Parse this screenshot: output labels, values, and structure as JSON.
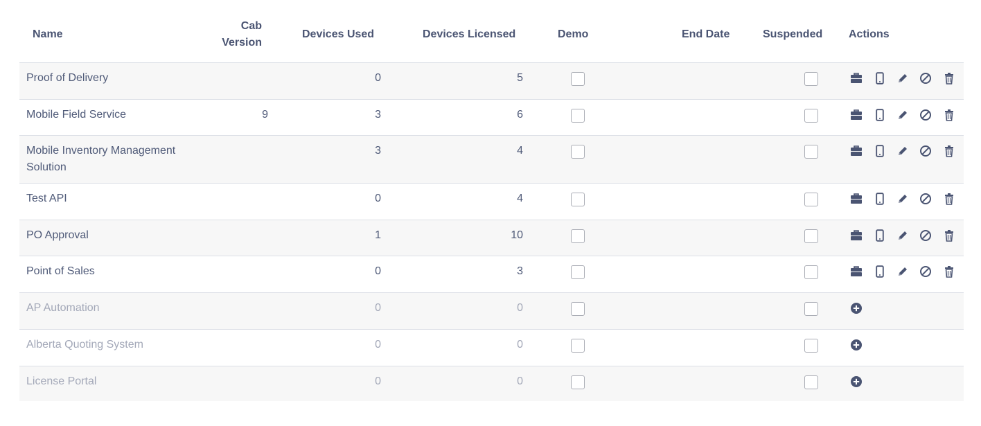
{
  "table": {
    "headers": {
      "name": "Name",
      "cab_line1": "Cab",
      "cab_line2": "Version",
      "used": "Devices Used",
      "licensed": "Devices Licensed",
      "demo": "Demo",
      "end_date": "End Date",
      "suspended": "Suspended",
      "actions": "Actions"
    },
    "rows": [
      {
        "name": "Proof of Delivery",
        "cab_version": "",
        "devices_used": "0",
        "devices_licensed": "5",
        "demo": false,
        "end_date": "",
        "suspended": false,
        "active": true
      },
      {
        "name": "Mobile Field Service",
        "cab_version": "9",
        "devices_used": "3",
        "devices_licensed": "6",
        "demo": false,
        "end_date": "",
        "suspended": false,
        "active": true
      },
      {
        "name": "Mobile Inventory Management Solution",
        "cab_version": "",
        "devices_used": "3",
        "devices_licensed": "4",
        "demo": false,
        "end_date": "",
        "suspended": false,
        "active": true
      },
      {
        "name": "Test API",
        "cab_version": "",
        "devices_used": "0",
        "devices_licensed": "4",
        "demo": false,
        "end_date": "",
        "suspended": false,
        "active": true
      },
      {
        "name": "PO Approval",
        "cab_version": "",
        "devices_used": "1",
        "devices_licensed": "10",
        "demo": false,
        "end_date": "",
        "suspended": false,
        "active": true
      },
      {
        "name": "Point of Sales",
        "cab_version": "",
        "devices_used": "0",
        "devices_licensed": "3",
        "demo": false,
        "end_date": "",
        "suspended": false,
        "active": true
      },
      {
        "name": "AP Automation",
        "cab_version": "",
        "devices_used": "0",
        "devices_licensed": "0",
        "demo": false,
        "end_date": "",
        "suspended": false,
        "active": false
      },
      {
        "name": "Alberta Quoting System",
        "cab_version": "",
        "devices_used": "0",
        "devices_licensed": "0",
        "demo": false,
        "end_date": "",
        "suspended": false,
        "active": false
      },
      {
        "name": "License Portal",
        "cab_version": "",
        "devices_used": "0",
        "devices_licensed": "0",
        "demo": false,
        "end_date": "",
        "suspended": false,
        "active": false
      }
    ]
  },
  "actions": {
    "active_icons": [
      "briefcase-icon",
      "mobile-device-icon",
      "pencil-edit-icon",
      "ban-suspend-icon",
      "trash-delete-icon"
    ],
    "inactive_icons": [
      "plus-circle-icon"
    ]
  },
  "colors": {
    "header_text": "#4a5472",
    "active_text": "#4f5a78",
    "inactive_text": "#a3a8b8",
    "icon": "#4a5472",
    "row_alt_bg": "#f7f7f7",
    "border": "#dcdfe6"
  }
}
